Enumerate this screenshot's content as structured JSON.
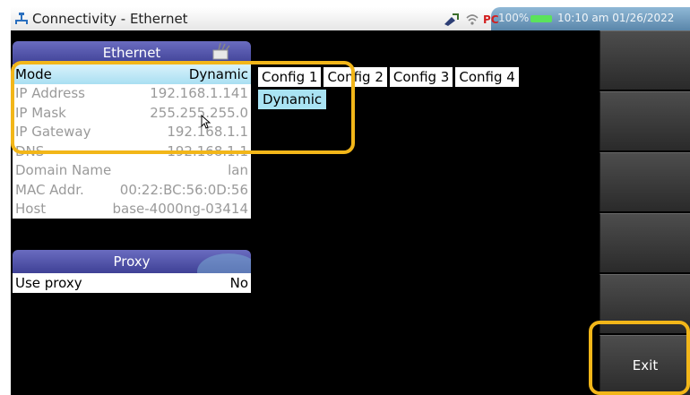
{
  "window": {
    "title": "Connectivity - Ethernet"
  },
  "status": {
    "battery": "100%",
    "clock": "10:10 am 01/26/2022"
  },
  "ethernet": {
    "header": "Ethernet",
    "rows": [
      {
        "label": "Mode",
        "value": "Dynamic"
      },
      {
        "label": "IP Address",
        "value": "192.168.1.141"
      },
      {
        "label": "IP Mask",
        "value": "255.255.255.0"
      },
      {
        "label": "IP Gateway",
        "value": "192.168.1.1"
      },
      {
        "label": "DNS",
        "value": "192.168.1.1"
      },
      {
        "label": "Domain Name",
        "value": "lan"
      },
      {
        "label": "MAC Addr.",
        "value": "00:22:BC:56:0D:56"
      },
      {
        "label": "Host",
        "value": "base-4000ng-03414"
      }
    ]
  },
  "proxy": {
    "header": "Proxy",
    "rows": [
      {
        "label": "Use proxy",
        "value": "No"
      }
    ]
  },
  "configs": {
    "tabs": [
      "Config 1",
      "Config 2",
      "Config 3",
      "Config 4"
    ],
    "mode_option": "Dynamic"
  },
  "softkeys": {
    "exit_label": "Exit"
  },
  "colors": {
    "highlight": "#f2b619",
    "panel_header": "#4a4ca8",
    "selection": "#a9e3f3",
    "status_bar": "#6f98bb"
  }
}
